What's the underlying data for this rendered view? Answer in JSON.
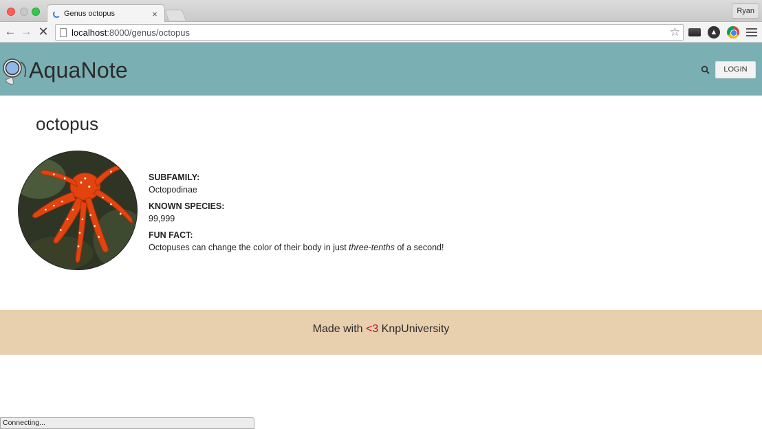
{
  "browser": {
    "tab": {
      "title": "Genus octopus",
      "close": "×"
    },
    "profile": "Ryan",
    "address": {
      "host": "localhost",
      "rest": ":8000/genus/octopus"
    },
    "status": "Connecting..."
  },
  "header": {
    "brand": "AquaNote",
    "login_label": "LOGIN"
  },
  "genus": {
    "name": "octopus",
    "fields": [
      {
        "label": "SUBFAMILY:",
        "value": "Octopodinae"
      },
      {
        "label": "KNOWN SPECIES:",
        "value": "99,999"
      },
      {
        "label": "FUN FACT:",
        "value_before": "Octopuses can change the color of their body in just ",
        "value_em": "three-tenths",
        "value_after": " of a second!"
      }
    ]
  },
  "footer": {
    "before": "Made with ",
    "heart": "<3",
    "after": " KnpUniversity"
  },
  "colors": {
    "header_bg": "#7ab0b3",
    "footer_bg": "#e8cfae",
    "heart": "#d0021b"
  }
}
